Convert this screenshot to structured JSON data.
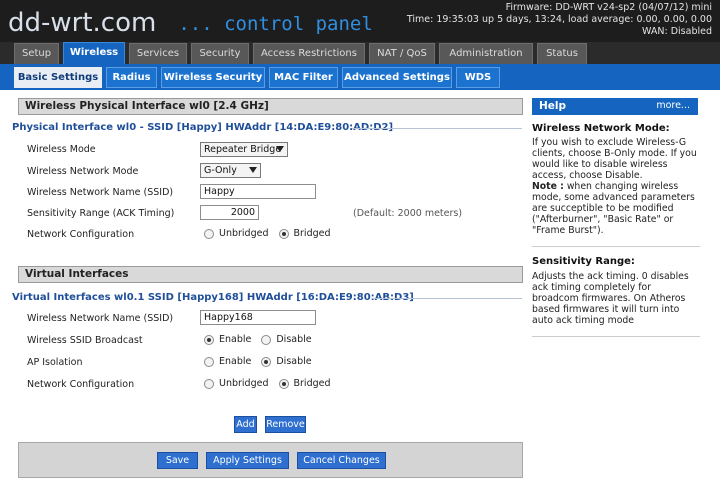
{
  "header": {
    "logo_main": "dd-wrt.com",
    "logo_sub": "... control panel",
    "firmware": "Firmware: DD-WRT v24-sp2 (04/07/12) mini",
    "time": "Time: 19:35:03 up 5 days, 13:24, load average: 0.00, 0.00, 0.00",
    "wan": "WAN: Disabled"
  },
  "main_tabs": [
    "Setup",
    "Wireless",
    "Services",
    "Security",
    "Access Restrictions",
    "NAT / QoS",
    "Administration",
    "Status"
  ],
  "active_main_tab": "Wireless",
  "sub_tabs": [
    "Basic Settings",
    "Radius",
    "Wireless Security",
    "MAC Filter",
    "Advanced Settings",
    "WDS"
  ],
  "active_sub_tab": "Basic Settings",
  "physical": {
    "section_title": "Wireless Physical Interface wl0 [2.4 GHz]",
    "iface_title": "Physical Interface wl0 - SSID [Happy] HWAddr [14:DA:E9:80:AD:D2]",
    "fields": {
      "mode_label": "Wireless Mode",
      "mode_value": "Repeater Bridge",
      "netmode_label": "Wireless Network Mode",
      "netmode_value": "G-Only",
      "ssid_label": "Wireless Network Name (SSID)",
      "ssid_value": "Happy",
      "ack_label": "Sensitivity Range (ACK Timing)",
      "ack_value": "2000",
      "ack_hint": "(Default: 2000 meters)",
      "netconf_label": "Network Configuration",
      "opt_unbridged": "Unbridged",
      "opt_bridged": "Bridged"
    }
  },
  "virtual": {
    "section_title": "Virtual Interfaces",
    "iface_title": "Virtual Interfaces wl0.1 SSID [Happy168] HWAddr [16:DA:E9:80:AB:D3]",
    "fields": {
      "ssid_label": "Wireless Network Name (SSID)",
      "ssid_value": "Happy168",
      "broadcast_label": "Wireless SSID Broadcast",
      "isolation_label": "AP Isolation",
      "netconf_label": "Network Configuration",
      "opt_enable": "Enable",
      "opt_disable": "Disable",
      "opt_unbridged": "Unbridged",
      "opt_bridged": "Bridged"
    }
  },
  "buttons": {
    "add": "Add",
    "remove": "Remove",
    "save": "Save",
    "apply": "Apply Settings",
    "cancel": "Cancel Changes"
  },
  "help": {
    "title": "Help",
    "more": "more...",
    "mode_title": "Wireless Network Mode:",
    "mode_text": "If you wish to exclude Wireless-G clients, choose B-Only mode. If you would like to disable wireless access, choose Disable.",
    "note_label": "Note :",
    "note_text": " when changing wireless mode, some advanced parameters are succeptible to be modified (\"Afterburner\", \"Basic Rate\" or \"Frame Burst\").",
    "sens_title": "Sensitivity Range:",
    "sens_text": "Adjusts the ack timing. 0 disables ack timing completely for broadcom firmwares. On Atheros based firmwares it will turn into auto ack timing mode"
  },
  "colors": {
    "header_bg": "#1d1d1d",
    "accent_blue": "#1565c0",
    "logo_blue": "#2f8fe0",
    "iface_title": "#1f4f99"
  }
}
